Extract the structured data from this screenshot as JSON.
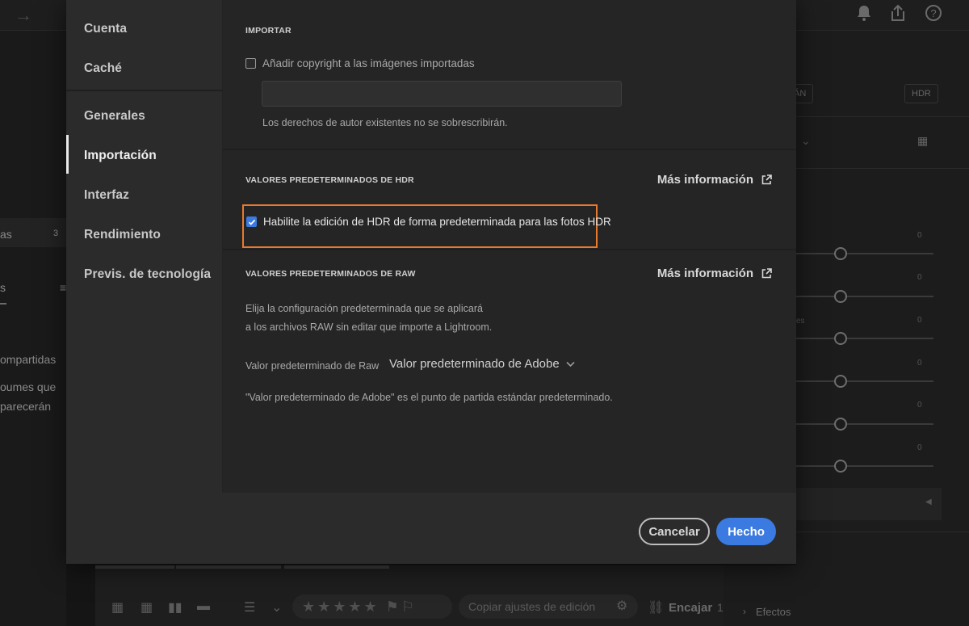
{
  "background": {
    "left_panel": {
      "row1_label": "as",
      "row1_count": "3",
      "row2_label": "s",
      "shared_title": "ompartidas",
      "shared_desc1": "oumes que",
      "shared_desc2": "parecerán"
    },
    "right_panel": {
      "chip_left": "ÁN",
      "chip_hdr": "HDR",
      "slider_zero": "0",
      "partial_label": "es"
    },
    "bottom_bar": {
      "copy_settings": "Copiar ajustes de edición",
      "fit_label": "Encajar",
      "fit_suffix": "1"
    },
    "bottom_right": {
      "effects_label": "Efectos"
    }
  },
  "modal": {
    "nav": {
      "items": [
        {
          "label": "Cuenta"
        },
        {
          "label": "Caché"
        },
        {
          "label": "Generales"
        },
        {
          "label": "Importación"
        },
        {
          "label": "Interfaz"
        },
        {
          "label": "Rendimiento"
        },
        {
          "label": "Previs. de tecnología"
        }
      ],
      "active_index": 3
    },
    "import_section": {
      "title": "IMPORTAR",
      "copyright_checkbox_label": "Añadir copyright a las imágenes importadas",
      "copyright_checked": false,
      "copyright_value": "",
      "help": "Los derechos de autor existentes no se sobrescribirán."
    },
    "hdr_section": {
      "title": "VALORES PREDETERMINADOS DE HDR",
      "more_info": "Más información",
      "checkbox_label": "Habilite la edición de HDR de forma predeterminada para las fotos HDR",
      "checked": true,
      "highlight_color": "#e87a2e"
    },
    "raw_section": {
      "title": "VALORES PREDETERMINADOS DE RAW",
      "more_info": "Más información",
      "description_line1": "Elija la configuración predeterminada que se aplicará",
      "description_line2": "a los archivos RAW sin editar que importe a Lightroom.",
      "raw_default_label": "Valor predeterminado de Raw",
      "raw_default_value": "Valor predeterminado de Adobe",
      "note": "\"Valor predeterminado de Adobe\" es el punto de partida estándar predeterminado."
    },
    "footer": {
      "cancel_label": "Cancelar",
      "done_label": "Hecho"
    }
  },
  "colors": {
    "accent": "#3b7ae0",
    "highlight": "#e87a2e"
  }
}
